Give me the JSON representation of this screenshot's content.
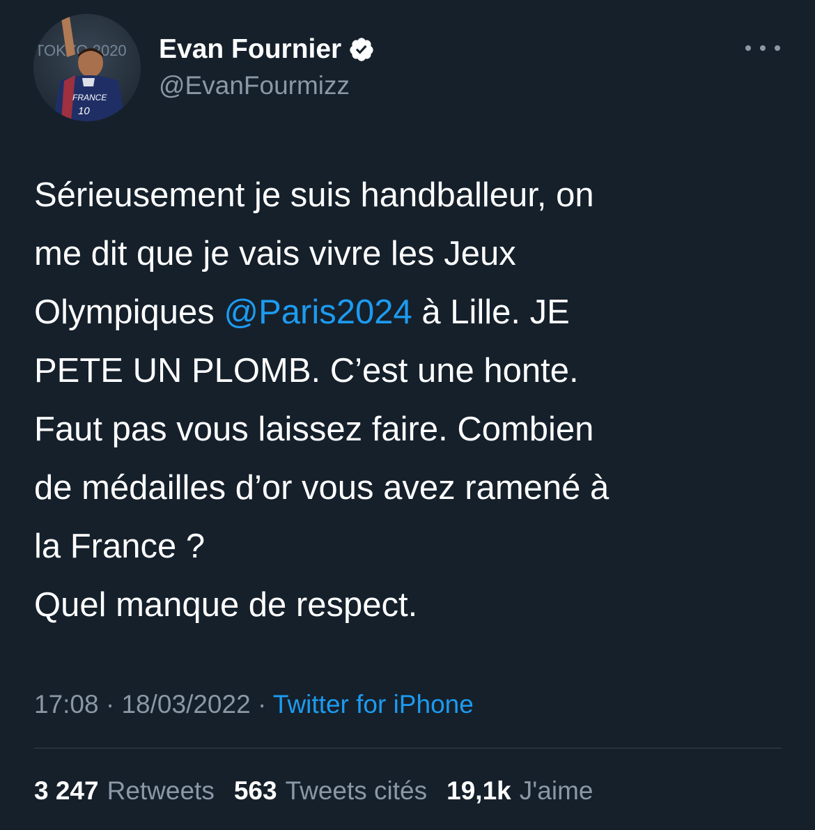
{
  "tweet": {
    "author": {
      "display_name": "Evan Fournier",
      "handle": "@EvanFourmizz",
      "verified_icon": "verified-badge-icon",
      "avatar_text": {
        "jersey_country": "FRANCE",
        "jersey_number": "10",
        "background_sign": "TOKYO 2020"
      }
    },
    "more_icon": "more-horizontal-icon",
    "body": {
      "line1": "Sérieusement je suis handballeur, on",
      "line2": "me dit que je vais vivre les Jeux",
      "line3_before": "Olympiques ",
      "line3_mention": "@Paris2024",
      "line3_after": " à Lille. JE",
      "line4": "PETE UN PLOMB. C’est une honte.",
      "line5": "Faut pas vous laissez faire. Combien",
      "line6": "de médailles d’or vous avez ramené à",
      "line7": "la France ?",
      "line8": "Quel manque de respect."
    },
    "meta": {
      "time": "17:08",
      "separator": " · ",
      "date": "18/03/2022",
      "source": "Twitter for iPhone"
    },
    "stats": {
      "retweets_count": "3 247",
      "retweets_label": "Retweets",
      "quotes_count": "563",
      "quotes_label": "Tweets cités",
      "likes_count": "19,1k",
      "likes_label": "J'aime"
    },
    "colors": {
      "background": "#15202b",
      "text": "#ffffff",
      "secondary": "#8b98a5",
      "accent": "#1d9bf0",
      "divider": "#38444d"
    }
  }
}
